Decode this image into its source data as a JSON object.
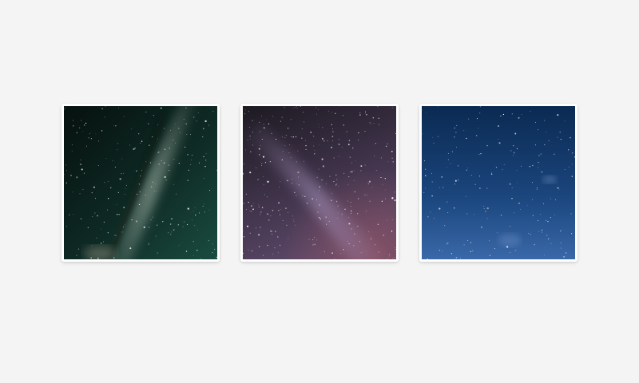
{
  "gallery": {
    "photos": [
      {
        "subject": "milky-way-green",
        "palette": {
          "dark": "#07140f",
          "mid": "#1c4a3d",
          "glow": "#7f9c8a"
        }
      },
      {
        "subject": "milky-way-purple",
        "palette": {
          "dark": "#1f1a24",
          "mid": "#5e4b6e",
          "glow": "#9a7fa6",
          "warm": "#8f4d55"
        }
      },
      {
        "subject": "starry-sky-blue",
        "palette": {
          "dark": "#0c2a52",
          "mid": "#1d4a82",
          "glow": "#5b86c4"
        }
      }
    ]
  }
}
